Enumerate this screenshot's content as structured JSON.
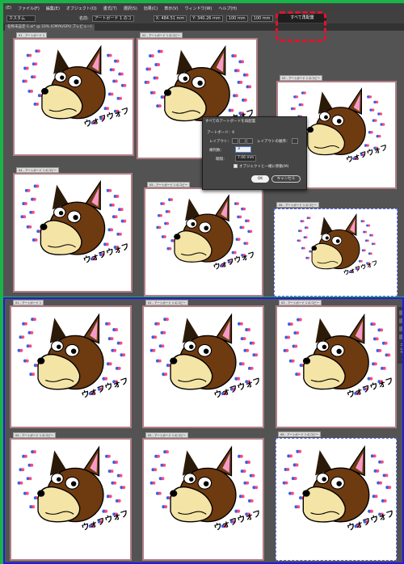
{
  "menu": {
    "items": [
      "ファイル(F)",
      "編集(E)",
      "オブジェクト(O)",
      "書式(T)",
      "選択(S)",
      "効果(C)",
      "表示(V)",
      "ウィンドウ(W)",
      "ヘルプ(H)"
    ],
    "leading": "(E)"
  },
  "control_bar": {
    "preset": "カスタム",
    "name_label": "名前:",
    "name_value": "アートボード 1 のコ",
    "x_value": "X: 484.51 mm",
    "y_value": "Y: 340.26 mm",
    "w_value": "100 mm",
    "h_value": "100 mm"
  },
  "doc_tab": "名称未設定-1.ai* @ 33% (CMYK/GPU プレビュー)",
  "rearrange_button": "すべて再配置",
  "artboard_labels": {
    "top": [
      "01 - アートボード 1",
      "02 - アートボード 1 のコピー",
      "03 - アートボード 1 のコピー",
      "04 - アートボード 1 のコピー",
      "05 - アートボード 1 のコピー",
      "06 - アートボード 1 のコピー"
    ],
    "bottom": [
      "01 - アートボード 1",
      "02 - アートボード 1 のコピー",
      "03 - アートボード 1 のコピー",
      "04 - アートボード 1 のコピー",
      "05 - アートボード 1 のコピー",
      "06 - アートボード 1 のコピー"
    ]
  },
  "art_text": "ウォフウォフ",
  "dialog": {
    "title": "すべてのアートボードを再配置",
    "artboards": "アートボード：6",
    "layout_label": "レイアウト：",
    "order_label": "レイアウトの順序：",
    "cols_label": "横列数：",
    "cols_value": "3",
    "spacing_label": "間隔：",
    "spacing_value": "7.06 mm",
    "move_art_label": "オブジェクトと一緒に移動(M)",
    "ok": "OK",
    "cancel": "キャンセル"
  },
  "side_panel_label": "ニ レイ",
  "colors": {
    "highlight": "#e0142d",
    "frame_green": "#19b34a",
    "frame_blue": "#2419e0",
    "canvas": "#535353",
    "dog_brown": "#6e3a10",
    "muzzle": "#f4e4a6"
  }
}
